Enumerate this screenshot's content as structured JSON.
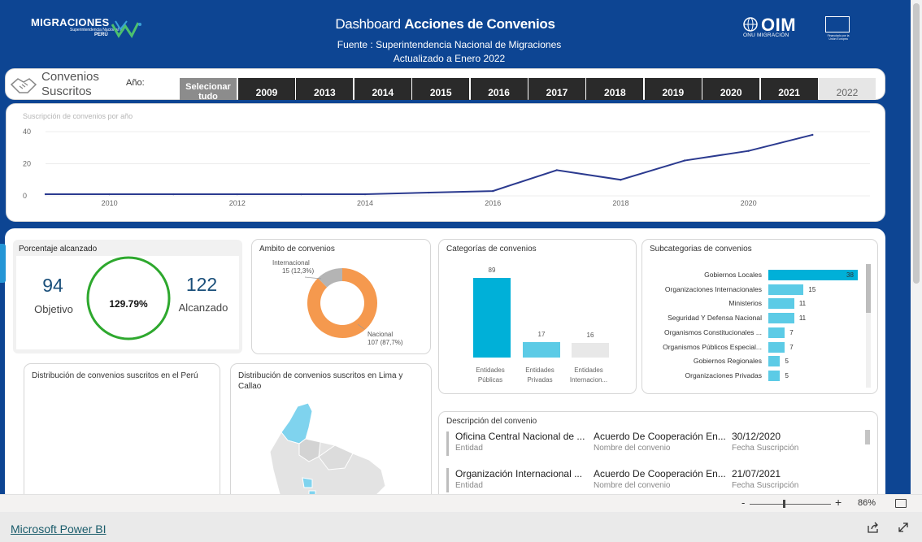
{
  "header": {
    "brand_name": "MIGRACIONES",
    "brand_sub": "Superintendencia Nacional de",
    "brand_country": "PERÚ",
    "title_plain": "Dashboard ",
    "title_bold": "Acciones de Convenios",
    "source": "Fuente : Superintendencia Nacional de Migraciones",
    "updated": "Actualizado a Enero 2022",
    "oim": "OIM",
    "oim_sub": "ONU MIGRACIÓN",
    "eu_text": "Financiado por la Unión Europea"
  },
  "slicer": {
    "title": "Convenios Suscritos",
    "year_label": "Año:",
    "select_all": "Selecionar tudo",
    "years": [
      "2009",
      "2013",
      "2014",
      "2015",
      "2016",
      "2017",
      "2018",
      "2019",
      "2020",
      "2021",
      "2022"
    ],
    "selected_year": "2022"
  },
  "line_chart": {
    "title": "Suscripción de convenios por año",
    "line_color": "#2b3a8f"
  },
  "kpi": {
    "title": "Porcentaje alcanzado",
    "objetivo_value": "94",
    "objetivo_label": "Objetivo",
    "alcanzado_value": "122",
    "alcanzado_label": "Alcanzado",
    "percent": "129.79%",
    "ring_color": "#2ea82e"
  },
  "ambito": {
    "title": "Ambito de convenios",
    "internacional_label": "Internacional",
    "internacional_value": "15 (12,3%)",
    "nacional_label": "Nacional",
    "nacional_value": "107 (87,7%)",
    "colors": {
      "nacional": "#f5994e",
      "internacional": "#b4b4b4"
    }
  },
  "categorias": {
    "title": "Categorías de convenios"
  },
  "subcategorias": {
    "title": "Subcategorias de convenios"
  },
  "map_peru": {
    "title": "Distribución de convenios suscritos en el Perú"
  },
  "map_lima": {
    "title": "Distribución de convenios suscritos en Lima y Callao"
  },
  "descripcion": {
    "title": "Descripción del convenio",
    "col_labels": [
      "Entidad",
      "Nombre del convenio",
      "Fecha Suscripción"
    ],
    "rows": [
      {
        "entidad": "Oficina Central Nacional de ...",
        "nombre": "Acuerdo De Cooperación En...",
        "fecha": "30/12/2020"
      },
      {
        "entidad": "Organización Internacional ...",
        "nombre": "Acuerdo De Cooperación En...",
        "fecha": "21/07/2021"
      }
    ]
  },
  "zoom": {
    "minus": "-",
    "plus": "+",
    "level": "86%"
  },
  "footer": {
    "link": "Microsoft Power BI"
  },
  "chart_data": [
    {
      "type": "line",
      "title": "Suscripción de convenios por año",
      "x": [
        2009,
        2010,
        2011,
        2012,
        2013,
        2014,
        2015,
        2016,
        2017,
        2018,
        2019,
        2020,
        2021
      ],
      "y": [
        1,
        1,
        1,
        1,
        1,
        1,
        2,
        3,
        16,
        10,
        22,
        28,
        38
      ],
      "xticks": [
        "2010",
        "2012",
        "2014",
        "2016",
        "2018",
        "2020"
      ],
      "yticks": [
        "0",
        "20",
        "40"
      ],
      "ylim": [
        0,
        40
      ],
      "grid": true
    },
    {
      "type": "bar",
      "title": "Categorías de convenios",
      "categories": [
        "Entidades Públicas",
        "Entidades Privadas",
        "Entidades Internacion..."
      ],
      "values": [
        89,
        17,
        16
      ],
      "colors": [
        "#00b0d8",
        "#5ccbe6",
        "#e8e8e8"
      ]
    },
    {
      "type": "bar",
      "orientation": "horizontal",
      "title": "Subcategorias de convenios",
      "categories": [
        "Gobiernos Locales",
        "Organizaciones Internacionales",
        "Ministerios",
        "Seguridad Y Defensa Nacional",
        "Organismos Constitucionales ...",
        "Organismos Públicos Especial...",
        "Gobiernos Regionales",
        "Organizaciones Privadas"
      ],
      "values": [
        38,
        15,
        11,
        11,
        7,
        7,
        5,
        5
      ],
      "colors": [
        "#00b0d8",
        "#5ccbe6"
      ]
    },
    {
      "type": "pie",
      "title": "Ambito de convenios",
      "categories": [
        "Nacional",
        "Internacional"
      ],
      "values": [
        107,
        15
      ]
    }
  ]
}
